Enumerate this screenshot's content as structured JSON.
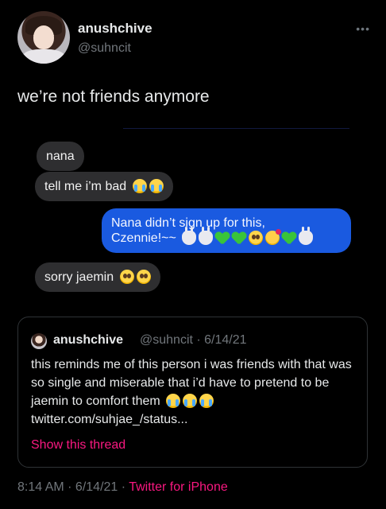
{
  "author": {
    "display_name": "anushchive",
    "handle": "@suhncit"
  },
  "more_icon": "more-options-icon",
  "tweet": {
    "text": "we’re not friends anymore"
  },
  "messages": [
    {
      "side": "left",
      "text": "nana",
      "emojis": []
    },
    {
      "side": "left",
      "text": "tell me i’m bad",
      "emojis": [
        "loudly-crying-face",
        "loudly-crying-face"
      ]
    },
    {
      "side": "right",
      "text_line1": "Nana didn’t sign up for this,",
      "text_line2": "Czennie!~~",
      "emojis": [
        "rabbit-face",
        "rabbit-face",
        "green-heart",
        "green-heart",
        "pleading-face",
        "smiling-face-with-hearts",
        "green-heart",
        "rabbit-face"
      ]
    },
    {
      "side": "left",
      "text": "sorry jaemin",
      "emojis": [
        "pleading-face",
        "pleading-face"
      ]
    }
  ],
  "quote": {
    "display_name": "anushchive",
    "meta": "@suhncit · 6/14/21",
    "text": "this reminds me of this person i was friends with that was so single and miserable that i’d have to pretend to be jaemin to comfort them",
    "link_url": "twitter.com/suhjae_/status...",
    "emojis": [
      "loudly-crying-face",
      "loudly-crying-face",
      "loudly-crying-face"
    ],
    "show_thread": "Show this thread"
  },
  "footer": {
    "time_date": "8:14 AM · 6/14/21 · ",
    "source": "Twitter for iPhone"
  },
  "colors": {
    "background": "#000000",
    "bubble_gray": "#2e2e30",
    "bubble_blue": "#1a5ae0",
    "accent": "#f91880",
    "muted": "#71767b"
  }
}
